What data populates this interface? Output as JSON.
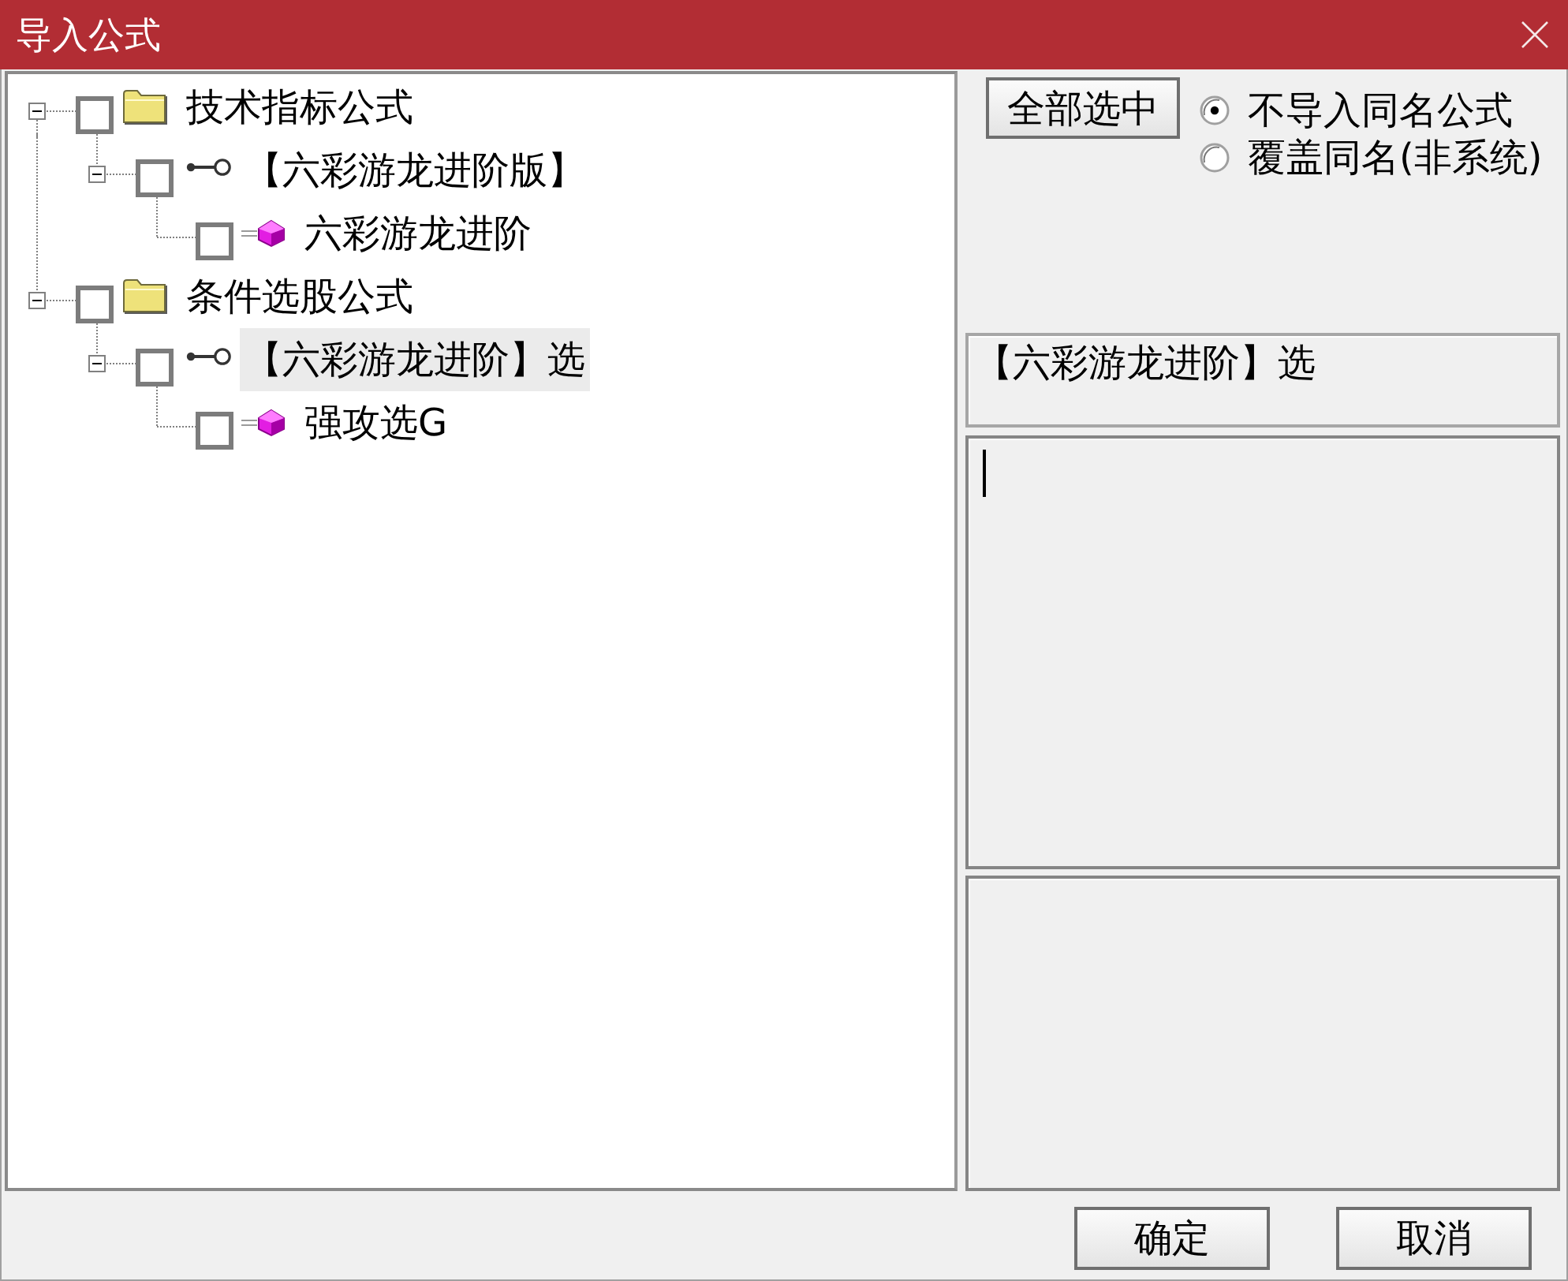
{
  "window": {
    "title": "导入公式"
  },
  "tree": {
    "items": [
      {
        "kind": "folder",
        "label": "技术指标公式",
        "checked": false,
        "selected": false,
        "expanded": true,
        "children": [
          {
            "kind": "group",
            "label": "【六彩游龙进阶版】",
            "checked": false,
            "selected": false,
            "expanded": true,
            "children": [
              {
                "kind": "formula",
                "label": "六彩游龙进阶",
                "checked": false,
                "selected": false
              }
            ]
          }
        ]
      },
      {
        "kind": "folder",
        "label": "条件选股公式",
        "checked": false,
        "selected": false,
        "expanded": true,
        "children": [
          {
            "kind": "group",
            "label": "【六彩游龙进阶】选",
            "checked": false,
            "selected": true,
            "expanded": true,
            "children": [
              {
                "kind": "formula",
                "label": "强攻选G",
                "checked": false,
                "selected": false
              }
            ]
          }
        ]
      }
    ]
  },
  "select_all_button": {
    "label": "全部选中"
  },
  "import_options": [
    {
      "label": "不导入同名公式",
      "selected": true
    },
    {
      "label": "覆盖同名(非系统)",
      "selected": false
    }
  ],
  "info_box": {
    "text": "【六彩游龙进阶】选"
  },
  "editor": {
    "focused": true
  },
  "buttons": [
    {
      "label": "确定"
    },
    {
      "label": "取消"
    }
  ]
}
